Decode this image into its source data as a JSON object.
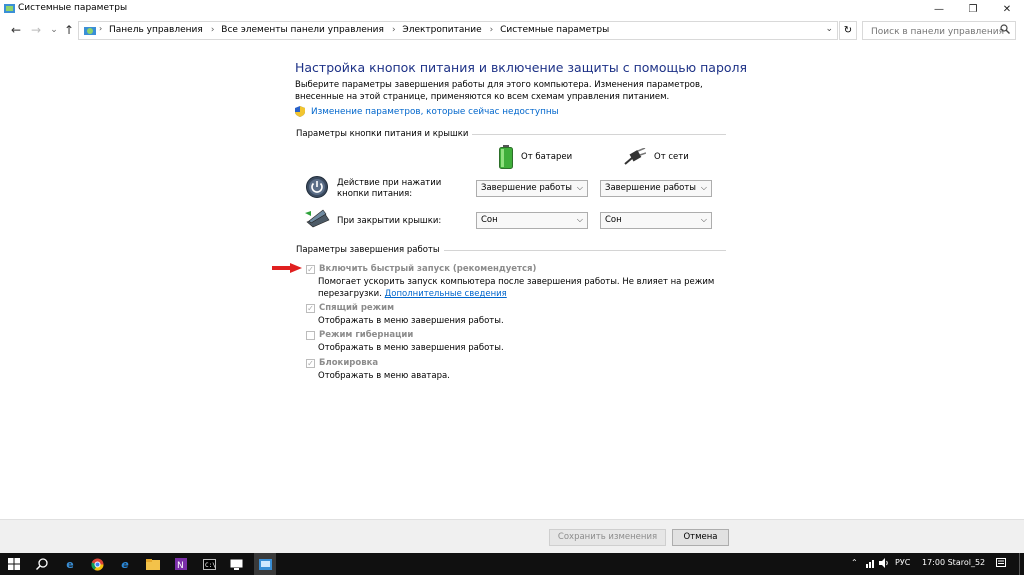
{
  "window": {
    "title": "Системные параметры",
    "controls": {
      "minimize": "—",
      "restore": "❐",
      "close": "✕"
    }
  },
  "nav": {
    "back": "←",
    "forward": "→",
    "history": "⌄",
    "up": "↑",
    "breadcrumbs": [
      "Панель управления",
      "Все элементы панели управления",
      "Электропитание",
      "Системные параметры"
    ],
    "dropdown": "⌄",
    "refresh": "↻",
    "search_placeholder": "Поиск в панели управления"
  },
  "page": {
    "heading": "Настройка кнопок питания и включение защиты с помощью пароля",
    "description": "Выберите параметры завершения работы для этого компьютера. Изменения параметров, внесенные на этой странице, применяются ко всем схемам управления питанием.",
    "elevate_link": "Изменение параметров, которые сейчас недоступны"
  },
  "power_buttons": {
    "group_title": "Параметры кнопки питания и крышки",
    "col_battery": "От батареи",
    "col_ac": "От сети",
    "rows": [
      {
        "label": "Действие при нажатии кнопки питания:",
        "battery": "Завершение работы",
        "ac": "Завершение работы"
      },
      {
        "label": "При закрытии крышки:",
        "battery": "Сон",
        "ac": "Сон"
      }
    ]
  },
  "shutdown": {
    "group_title": "Параметры завершения работы",
    "items": [
      {
        "label": "Включить быстрый запуск (рекомендуется)",
        "checked": true,
        "description": "Помогает ускорить запуск компьютера после завершения работы. Не влияет на режим перезагрузки.",
        "link": "Дополнительные сведения"
      },
      {
        "label": "Спящий режим",
        "checked": true,
        "description": "Отображать в меню завершения работы."
      },
      {
        "label": "Режим гибернации",
        "checked": false,
        "description": "Отображать в меню завершения работы."
      },
      {
        "label": "Блокировка",
        "checked": true,
        "description": "Отображать в меню аватара."
      }
    ]
  },
  "footer": {
    "save": "Сохранить изменения",
    "cancel": "Отмена"
  },
  "taskbar": {
    "language": "РУС",
    "clock": "17:00 Starol_52"
  },
  "colors": {
    "heading": "#1e3287",
    "link": "#0066cc",
    "annotation_arrow": "#e02020",
    "taskbar": "#101010"
  }
}
